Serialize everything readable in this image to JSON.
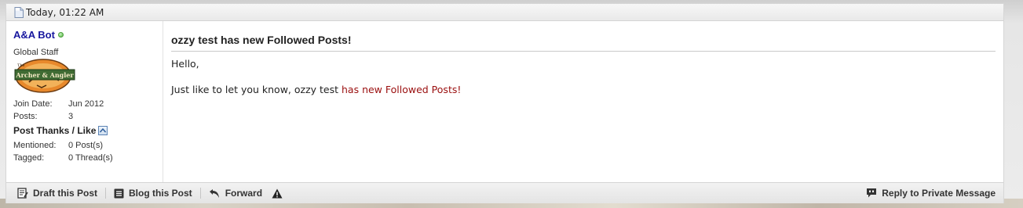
{
  "post": {
    "date": "Today, 01:22 AM",
    "title": "ozzy test has new Followed Posts!",
    "greeting": "Hello,",
    "message_prefix": "Just like to let you know, ozzy test ",
    "message_link": "has new Followed Posts!"
  },
  "user": {
    "name": "A&A Bot",
    "title": "Global Staff",
    "avatar_top": "Archer & Angler",
    "avatar_tag": "The",
    "join_date_label": "Join Date:",
    "join_date": "Jun 2012",
    "posts_label": "Posts:",
    "posts": "3",
    "thanks_title": "Post Thanks / Like",
    "mentioned_label": "Mentioned:",
    "mentioned": "0 Post(s)",
    "tagged_label": "Tagged:",
    "tagged": "0 Thread(s)"
  },
  "footer": {
    "draft_label": "Draft this Post",
    "blog_label": "Blog this Post",
    "forward_label": "Forward",
    "reply_label": "Reply to Private Message"
  },
  "colors": {
    "username": "#17179e",
    "link": "#9a0e0e"
  }
}
